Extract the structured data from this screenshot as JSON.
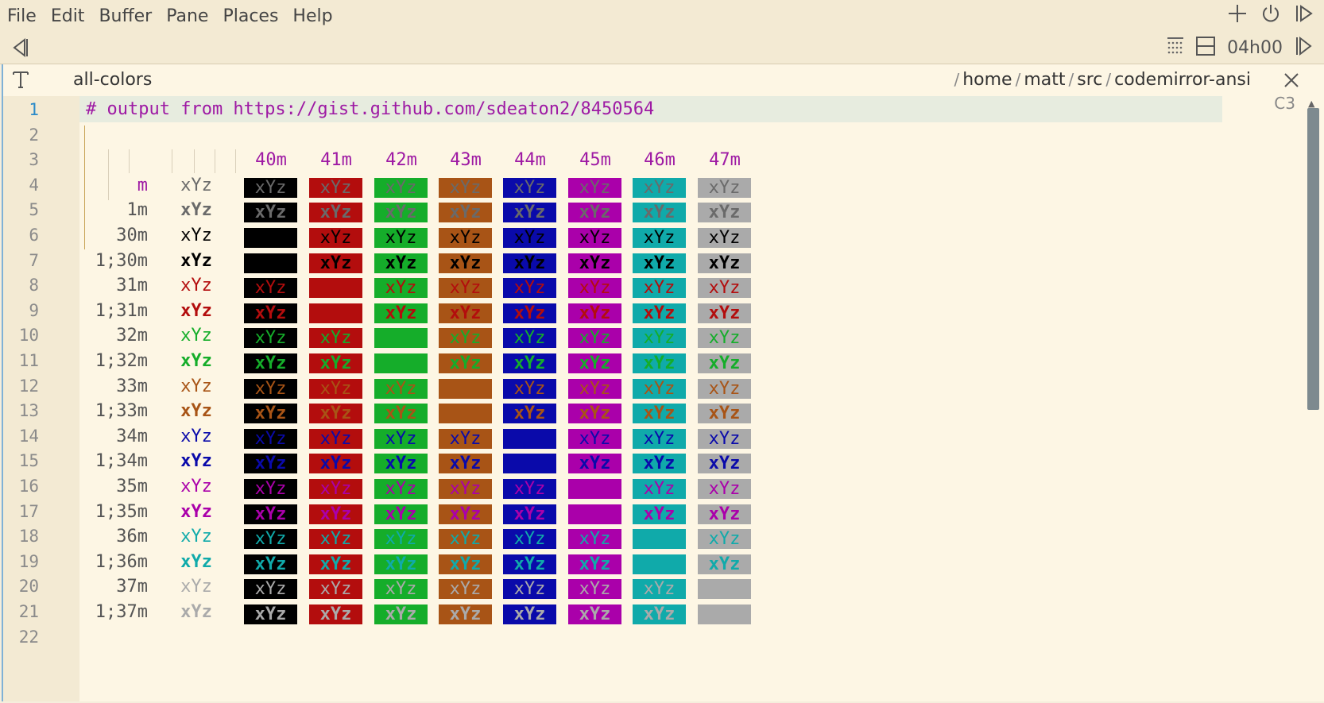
{
  "menu": [
    "File",
    "Edit",
    "Buffer",
    "Pane",
    "Places",
    "Help"
  ],
  "top_icons": [
    "plus-icon",
    "power-icon",
    "panel-toggle-icon"
  ],
  "toolbar": {
    "back_icon": "triangle-left-icon",
    "grid_icon": "dotted-grid-icon",
    "split_icon": "split-pane-icon",
    "timer": "04h00",
    "forward_icon": "triangle-right-icon"
  },
  "buffer": {
    "name": "all-colors",
    "path": [
      "home",
      "matt",
      "src",
      "codemirror-ansi"
    ],
    "cursor_col": "C3"
  },
  "editor": {
    "comment": "# output from https://gist.github.com/sdeaton2/8450564",
    "line_numbers": [
      "1",
      "2",
      "3",
      "4",
      "5",
      "6",
      "7",
      "8",
      "9",
      "10",
      "11",
      "12",
      "13",
      "14",
      "15",
      "16",
      "17",
      "18",
      "19",
      "20",
      "21",
      "22"
    ],
    "active_line": 1,
    "sample_text": "xYz",
    "bg_headers": [
      "40m",
      "41m",
      "42m",
      "43m",
      "44m",
      "45m",
      "46m",
      "47m"
    ],
    "rows": [
      {
        "label": "m",
        "fg": "default",
        "bold": false
      },
      {
        "label": "1m",
        "fg": "default",
        "bold": true
      },
      {
        "label": "30m",
        "fg": "30",
        "bold": false
      },
      {
        "label": "1;30m",
        "fg": "30",
        "bold": true
      },
      {
        "label": "31m",
        "fg": "31",
        "bold": false
      },
      {
        "label": "1;31m",
        "fg": "31",
        "bold": true
      },
      {
        "label": "32m",
        "fg": "32",
        "bold": false
      },
      {
        "label": "1;32m",
        "fg": "32",
        "bold": true
      },
      {
        "label": "33m",
        "fg": "33",
        "bold": false
      },
      {
        "label": "1;33m",
        "fg": "33",
        "bold": true
      },
      {
        "label": "34m",
        "fg": "34",
        "bold": false
      },
      {
        "label": "1;34m",
        "fg": "34",
        "bold": true
      },
      {
        "label": "35m",
        "fg": "35",
        "bold": false
      },
      {
        "label": "1;35m",
        "fg": "35",
        "bold": true
      },
      {
        "label": "36m",
        "fg": "36",
        "bold": false
      },
      {
        "label": "1;36m",
        "fg": "36",
        "bold": true
      },
      {
        "label": "37m",
        "fg": "37",
        "bold": false
      },
      {
        "label": "1;37m",
        "fg": "37",
        "bold": true
      }
    ]
  },
  "colors": {
    "bg": {
      "40": "#000000",
      "41": "#b30d0d",
      "42": "#15ad2a",
      "43": "#a85416",
      "44": "#0a0aaa",
      "45": "#aa00aa",
      "46": "#10aaaa",
      "47": "#aaaaaa"
    },
    "fg": {
      "default": "#6a6a6a",
      "30": "#000000",
      "31": "#b30d0d",
      "32": "#15ad2a",
      "33": "#a85416",
      "34": "#0a0aaa",
      "35": "#aa00aa",
      "36": "#10aaaa",
      "37": "#aaaaaa"
    },
    "label_fg": "#555555",
    "comment": "#9e1aa4",
    "accent": "#2a8ac9"
  }
}
